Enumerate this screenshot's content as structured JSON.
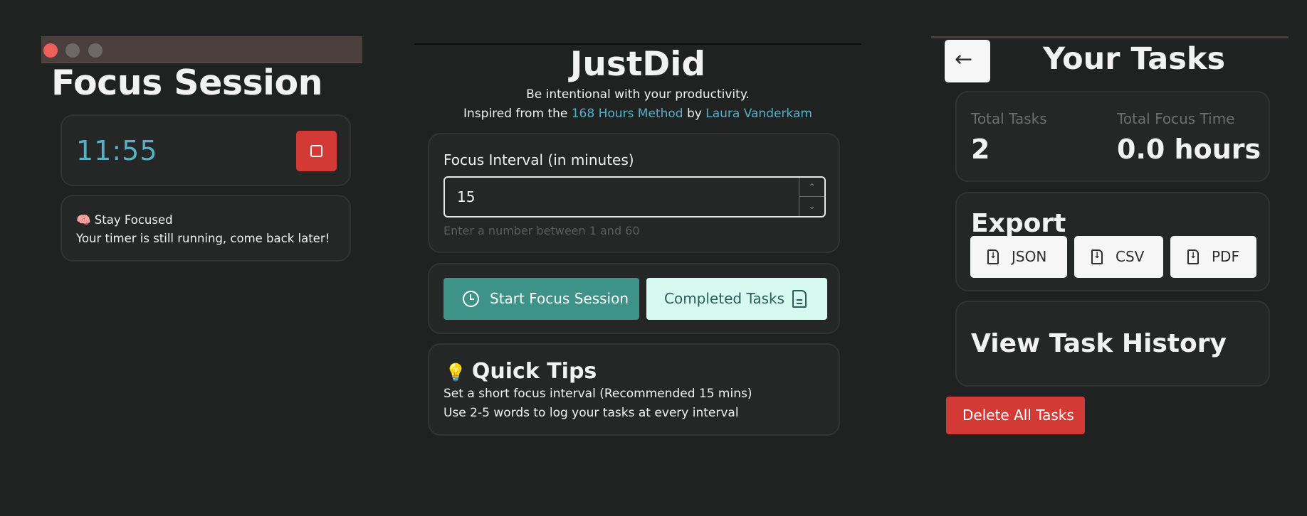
{
  "left_panel": {
    "window_controls": [
      "close",
      "minimize",
      "zoom"
    ],
    "title": "Focus Session",
    "timer": "11:55",
    "stop_icon": "stop-square-icon",
    "message_title": "🧠 Stay Focused",
    "message_body": "Your timer is still running, come back later!"
  },
  "middle_panel": {
    "app_title": "JustDid",
    "tagline": "Be intentional with your productivity.",
    "inspired_prefix": "Inspired from the ",
    "method_link": "168 Hours Method",
    "by_text": " by ",
    "author_link": "Laura Vanderkam",
    "interval_label": "Focus Interval (in minutes)",
    "interval_value": "15",
    "interval_helper": "Enter a number between 1 and 60",
    "start_button": "Start Focus Session",
    "completed_button": "Completed Tasks",
    "tips_icon": "💡",
    "tips_title": "Quick Tips",
    "tips": [
      "Set a short focus interval (Recommended 15 mins)",
      "Use 2-5 words to log your tasks at every interval"
    ]
  },
  "right_panel": {
    "back_icon": "←",
    "title": "Your Tasks",
    "stats": {
      "total_tasks_label": "Total Tasks",
      "total_tasks_value": "2",
      "focus_time_label": "Total Focus Time",
      "focus_time_value": "0.0 hours"
    },
    "export_title": "Export",
    "export_buttons": [
      "JSON",
      "CSV",
      "PDF"
    ],
    "history_label": "View Task History",
    "delete_button": "Delete All Tasks"
  },
  "colors": {
    "background": "#202221",
    "accent_teal": "#3e9389",
    "timer_blue": "#56b0c8",
    "danger_red": "#d33a35",
    "mint": "#d6f9f0"
  }
}
